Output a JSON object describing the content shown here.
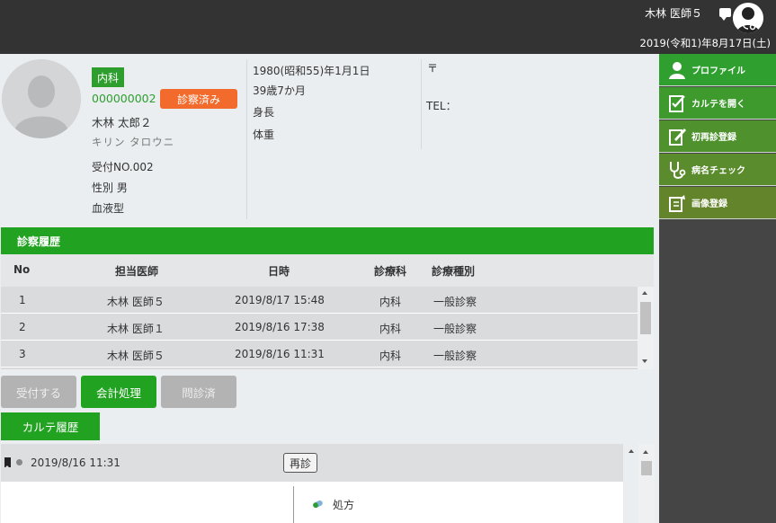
{
  "header": {
    "user_name": "木林 医師５",
    "date": "2019(令和1)年8月17日(土)"
  },
  "sidebar": {
    "items": [
      {
        "label": "プロファイル",
        "icon": "person-icon",
        "color": "#2fa02f"
      },
      {
        "label": "カルテを開く",
        "icon": "clipboard-check-icon",
        "color": "#3f9a2e"
      },
      {
        "label": "初再診登録",
        "icon": "clipboard-edit-icon",
        "color": "#4f922d"
      },
      {
        "label": "病名チェック",
        "icon": "stethoscope-icon",
        "color": "#5a8b2c"
      },
      {
        "label": "画像登録",
        "icon": "image-edit-icon",
        "color": "#64842b"
      }
    ]
  },
  "patient": {
    "department": "内科",
    "id": "000000002",
    "status": "診察済み",
    "name": "木林 太郎２",
    "kana": "キリン タロウニ",
    "receipt_no": "受付NO.002",
    "sex": "性別 男",
    "blood": "血液型",
    "birth": "1980(昭和55)年1月1日",
    "age": "39歳7か月",
    "height_label": "身長",
    "weight_label": "体重",
    "postal": "〒",
    "tel": "TEL："
  },
  "exam_history": {
    "title": "診察履歴",
    "columns": [
      "No",
      "担当医師",
      "日時",
      "診療科",
      "診療種別"
    ],
    "rows": [
      {
        "no": "1",
        "doctor": "木林 医師５",
        "datetime": "2019/8/17 15:48",
        "dept": "内科",
        "type": "一般診察"
      },
      {
        "no": "2",
        "doctor": "木林 医師１",
        "datetime": "2019/8/16 17:38",
        "dept": "内科",
        "type": "一般診察"
      },
      {
        "no": "3",
        "doctor": "木林 医師５",
        "datetime": "2019/8/16 11:31",
        "dept": "内科",
        "type": "一般診察"
      }
    ]
  },
  "actions": {
    "reception": "受付する",
    "billing": "会計処理",
    "interviewed": "問診済"
  },
  "karte": {
    "tab_label": "カルテ履歴",
    "entry_date": "2019/8/16 11:31",
    "revisit_label": "再診",
    "prescription_label": "処方"
  },
  "colors": {
    "accent_green": "#21a321",
    "status_orange": "#f26b2c",
    "header_dark": "#333333"
  }
}
